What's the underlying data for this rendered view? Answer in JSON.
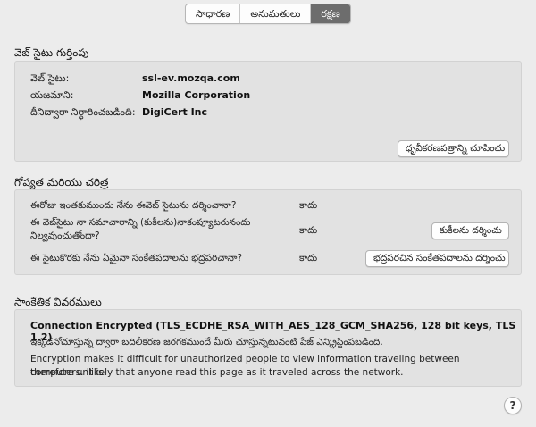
{
  "tabs": [
    {
      "label": "సాధారణ",
      "selected": false
    },
    {
      "label": "అనుమతులు",
      "selected": false
    },
    {
      "label": "రక్షణ",
      "selected": true
    }
  ],
  "identity": {
    "title": "వెబ్ సైటు గుర్తింపు",
    "rows": [
      {
        "label": "వెబ్ సైటు:",
        "value": "ssl-ev.mozqa.com"
      },
      {
        "label": "యజమాని:",
        "value": "Mozilla Corporation"
      },
      {
        "label": "దీనిద్వారా నిర్ధారించబడింది:",
        "value": "DigiCert Inc"
      }
    ],
    "button_label": "ధృవీకరణపత్రాన్ని చూపించు"
  },
  "privacy": {
    "title": "గోప్యత మరియు చరిత్ర",
    "rows": [
      {
        "question": "ఈరోజు ఇంతకుముందు నేను ఈవెబ్ సైటును దర్శించానా?",
        "answer": "కాదు"
      },
      {
        "question": "ఈ వెబ్‌సైటు నా సమాచారాన్ని (కుకీలను)నాకంప్యూటరునందు నిల్వవుంచుతోందా?",
        "answer": "కాదు",
        "button": "కుకీలను దర్శించు"
      },
      {
        "question": "ఈ సైటుకొరకు నేను ఏమైనా సంకేతపదాలను భద్రపరిచానా?",
        "answer": "కాదు",
        "button": "భద్రపరచిన సంకేతపదాలను దర్శించు"
      }
    ]
  },
  "technical": {
    "title": "సాంకేతిక వివరములు",
    "connection": "Connection Encrypted (TLS_ECDHE_RSA_WITH_AES_128_GCM_SHA256, 128 bit keys, TLS 1.2)",
    "line1": "ఇక్కడనోచూస్తున్న ద్వారా బదిలీకరణ జరగకముందే మీరు చూస్తున్నటువంటి పేజ్ ఎన్క్రిప్టింపబడింది.",
    "line2": "Encryption makes it difficult for unauthorized people to view information traveling between computers. It is",
    "line3": "therefore unlikely that anyone read this page as it traveled across the network."
  },
  "help_label": "?"
}
